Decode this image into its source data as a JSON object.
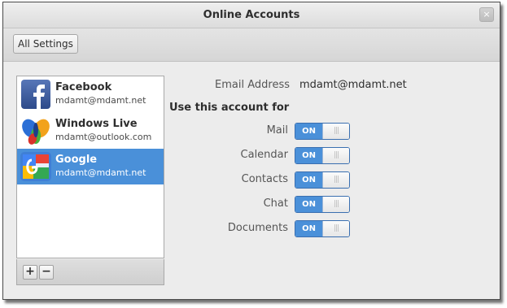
{
  "window": {
    "title": "Online Accounts",
    "close_glyph": "×"
  },
  "toolbar": {
    "all_settings_label": "All Settings"
  },
  "accounts": [
    {
      "name": "Facebook",
      "email": "mdamt@mdamt.net",
      "icon": "facebook-icon",
      "selected": false
    },
    {
      "name": "Windows Live",
      "email": "mdamt@outlook.com",
      "icon": "windows-live-icon",
      "selected": false
    },
    {
      "name": "Google",
      "email": "mdamt@mdamt.net",
      "icon": "google-icon",
      "selected": true
    }
  ],
  "list_toolbar": {
    "add_label": "+",
    "remove_label": "−"
  },
  "details": {
    "email_label": "Email Address",
    "email_value": "mdamt@mdamt.net",
    "use_for_heading": "Use this account for",
    "services": [
      {
        "label": "Mail",
        "state": "ON"
      },
      {
        "label": "Calendar",
        "state": "ON"
      },
      {
        "label": "Contacts",
        "state": "ON"
      },
      {
        "label": "Chat",
        "state": "ON"
      },
      {
        "label": "Documents",
        "state": "ON"
      }
    ],
    "toggle_knob_glyph": "|||"
  },
  "colors": {
    "accent": "#4a90d9",
    "selection_text": "#ffffff"
  }
}
